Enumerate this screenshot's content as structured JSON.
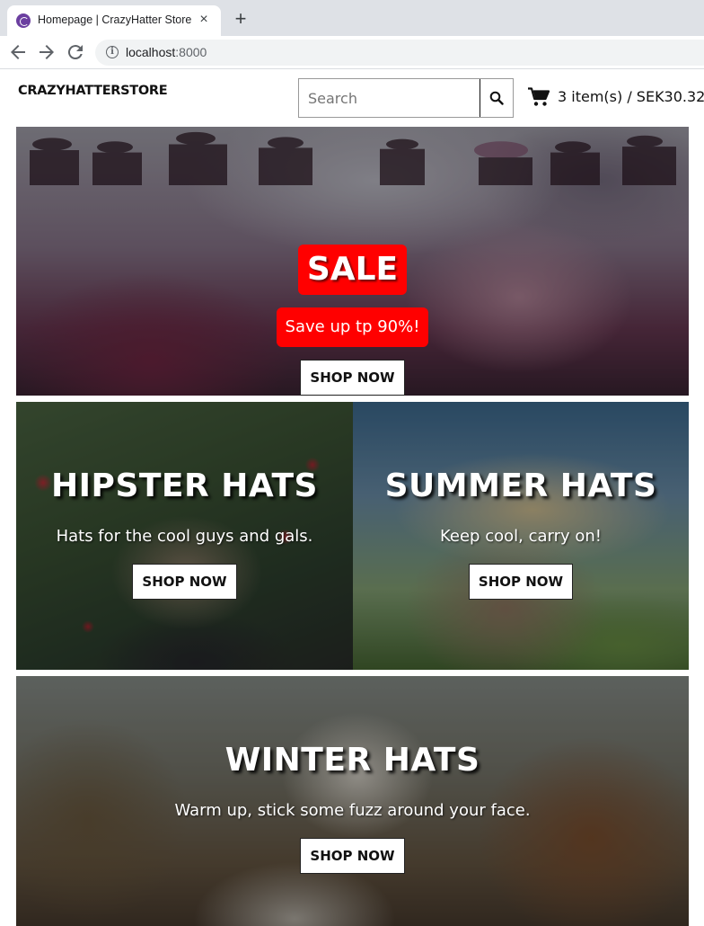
{
  "browser": {
    "tab_title": "Homepage | CrazyHatter Store",
    "tab_close": "×",
    "new_tab": "+",
    "url_host": "localhost",
    "url_port": ":8000",
    "info_glyph": "i"
  },
  "header": {
    "logo": "CRAZYHATTERSTORE",
    "search_placeholder": "Search",
    "cart_text": "3 item(s) / SEK30.32"
  },
  "sale_banner": {
    "badge": "SALE",
    "subtitle": "Save up tp 90%!",
    "button": "SHOP NOW"
  },
  "categories": [
    {
      "title": "HIPSTER HATS",
      "subtitle": "Hats for the cool guys and gals.",
      "button": "SHOP NOW"
    },
    {
      "title": "SUMMER HATS",
      "subtitle": "Keep cool, carry on!",
      "button": "SHOP NOW"
    },
    {
      "title": "WINTER HATS",
      "subtitle": "Warm up, stick some fuzz around your face.",
      "button": "SHOP NOW"
    }
  ],
  "colors": {
    "sale_red": "#ff0000",
    "tab_strip": "#dee1e6",
    "favicon": "#6b3fa0"
  }
}
